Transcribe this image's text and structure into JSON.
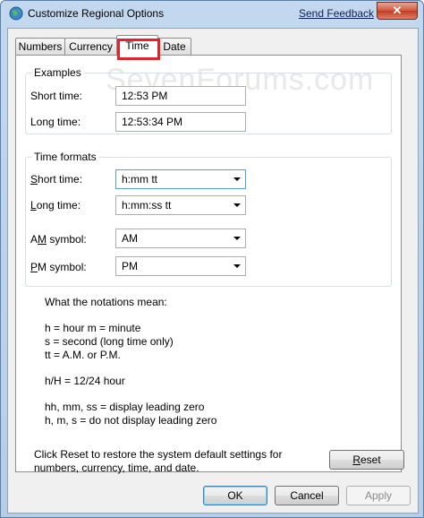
{
  "window": {
    "title": "Customize Regional Options",
    "feedback_link": "Send Feedback",
    "close_glyph": "✕"
  },
  "tabs": [
    {
      "label": "Numbers"
    },
    {
      "label": "Currency"
    },
    {
      "label": "Time"
    },
    {
      "label": "Date"
    }
  ],
  "watermark": "SevenForums.com",
  "examples": {
    "group_label": "Examples",
    "short_time_label": "Short time:",
    "short_time_value": "12:53 PM",
    "long_time_label": "Long time:",
    "long_time_value": "12:53:34 PM"
  },
  "time_formats": {
    "group_label": "Time formats",
    "short_time_label_pre": "",
    "short_time_label_key": "S",
    "short_time_label_post": "hort time:",
    "short_time_value": "h:mm tt",
    "long_time_label_pre": "",
    "long_time_label_key": "L",
    "long_time_label_post": "ong time:",
    "long_time_value": "h:mm:ss tt",
    "am_label_pre": "A",
    "am_label_key": "M",
    "am_label_post": " symbol:",
    "am_value": "AM",
    "pm_label_pre": "",
    "pm_label_key": "P",
    "pm_label_post": "M symbol:",
    "pm_value": "PM"
  },
  "notations": {
    "heading": "What the notations mean:",
    "line1": "h = hour   m = minute",
    "line2": "s = second (long time only)",
    "line3": "tt = A.M. or P.M.",
    "line4": "h/H = 12/24 hour",
    "line5": "hh, mm, ss = display leading zero",
    "line6": "h, m, s = do not display leading zero"
  },
  "reset": {
    "text_line1": "Click Reset to restore the system default settings for",
    "text_line2": "numbers, currency, time, and date.",
    "button_key": "R",
    "button_rest": "eset"
  },
  "footer": {
    "ok": "OK",
    "cancel": "Cancel",
    "apply": "Apply"
  },
  "colors": {
    "highlight": "#e0242b",
    "link": "#0b1f58"
  }
}
